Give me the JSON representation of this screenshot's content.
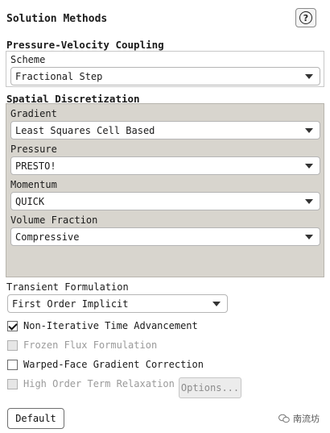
{
  "panel": {
    "title": "Solution Methods",
    "help_icon": "question-icon"
  },
  "pressure_velocity": {
    "heading": "Pressure-Velocity Coupling",
    "scheme_label": "Scheme",
    "scheme_value": "Fractional Step"
  },
  "spatial": {
    "heading": "Spatial Discretization",
    "items": [
      {
        "label": "Gradient",
        "value": "Least Squares Cell Based"
      },
      {
        "label": "Pressure",
        "value": "PRESTO!"
      },
      {
        "label": "Momentum",
        "value": "QUICK"
      },
      {
        "label": "Volume Fraction",
        "value": "Compressive"
      }
    ]
  },
  "transient": {
    "label": "Transient Formulation",
    "value": "First Order Implicit"
  },
  "checkboxes": [
    {
      "label": "Non-Iterative Time Advancement",
      "checked": true,
      "enabled": true
    },
    {
      "label": "Frozen Flux Formulation",
      "checked": false,
      "enabled": false
    },
    {
      "label": "Warped-Face Gradient Correction",
      "checked": false,
      "enabled": true
    },
    {
      "label": "High Order Term Relaxation",
      "checked": false,
      "enabled": false
    }
  ],
  "buttons": {
    "options": "Options...",
    "default": "Default"
  },
  "watermark": {
    "text": "南流坊",
    "icon": "wechat-icon"
  }
}
